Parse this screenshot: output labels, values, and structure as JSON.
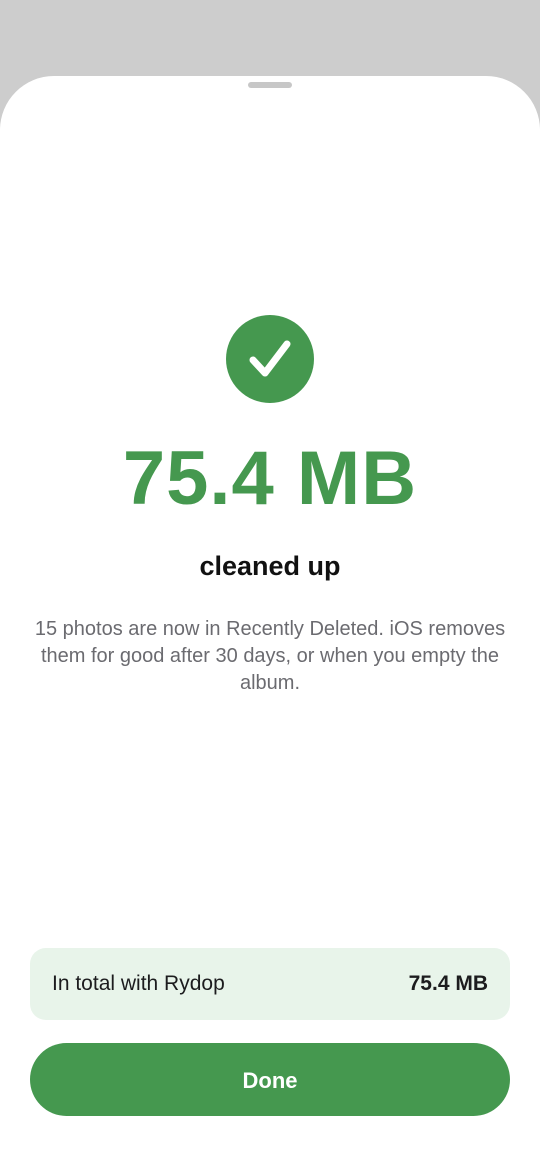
{
  "sheet": {
    "headline_size": "75.4 MB",
    "subtitle": "cleaned up",
    "description": "15 photos are now in Recently Deleted. iOS removes them for good after 30 days, or when you empty the album.",
    "total": {
      "label": "In total with Rydop",
      "value": "75.4 MB"
    },
    "done_label": "Done"
  },
  "icons": {
    "success": "checkmark-circle-icon"
  },
  "colors": {
    "accent": "#45984f",
    "card_background": "#e8f4ea",
    "backdrop": "#cdcdcd"
  }
}
